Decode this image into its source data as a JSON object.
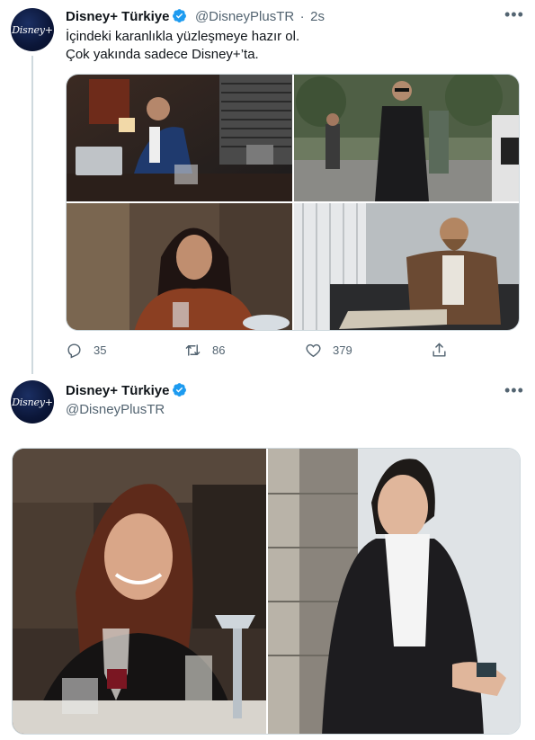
{
  "tweet1": {
    "author_name": "Disney+ Türkiye",
    "handle": "@DisneyPlusTR",
    "separator": "·",
    "time": "2s",
    "avatar_logo_text": "Disney+",
    "text_line1": "İçindeki karanlıkla yüzleşmeye hazır ol.",
    "text_line2": "Çok yakında sadece Disney+’ta.",
    "images": [
      {
        "icon": "photo-office-man-laptop"
      },
      {
        "icon": "photo-man-sunglasses-walking"
      },
      {
        "icon": "photo-woman-dark-hair"
      },
      {
        "icon": "photo-bearded-man-sofa"
      }
    ],
    "actions": {
      "reply_count": "35",
      "retweet_count": "86",
      "like_count": "379"
    }
  },
  "tweet2": {
    "author_name": "Disney+ Türkiye",
    "handle": "@DisneyPlusTR",
    "avatar_logo_text": "Disney+",
    "images": [
      {
        "icon": "photo-woman-smiling-restaurant"
      },
      {
        "icon": "photo-young-woman-dark-coat"
      }
    ]
  },
  "colors": {
    "verified_blue": "#1d9bf0",
    "secondary_text": "#536471",
    "thread_line": "#cfd9de"
  }
}
